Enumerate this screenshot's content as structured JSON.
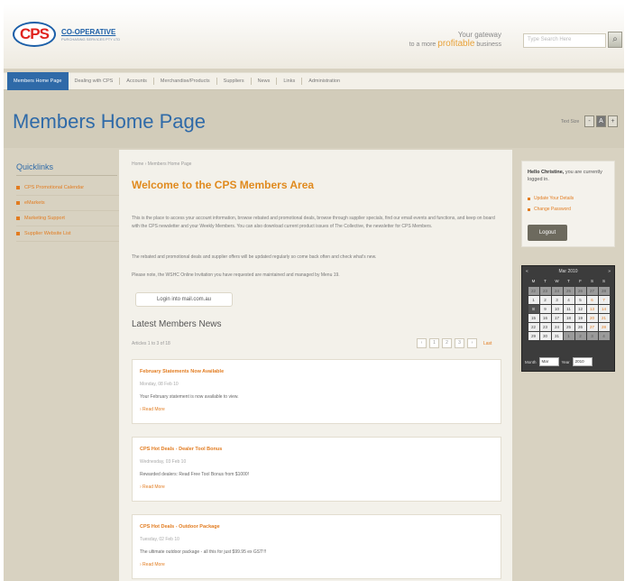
{
  "header": {
    "logo_mark": "CPS",
    "logo_name": "CO-OPERATIVE",
    "logo_sub": "PURCHASING SERVICES PTY LTD",
    "tagline_line1": "Your gateway",
    "tagline_pre": "to a more",
    "tagline_emph": "profitable",
    "tagline_post": "business",
    "search_placeholder": "Type Search Here",
    "search_icon": "search-icon"
  },
  "nav": {
    "items": [
      {
        "label": "Members Home Page",
        "active": true
      },
      {
        "label": "Dealing with CPS"
      },
      {
        "label": "Accounts"
      },
      {
        "label": "Merchandise/Products"
      },
      {
        "label": "Suppliers"
      },
      {
        "label": "News"
      },
      {
        "label": "Links"
      },
      {
        "label": "Administration"
      }
    ]
  },
  "page": {
    "title": "Members Home Page",
    "text_size_label": "Text Size",
    "text_size_buttons": [
      "-",
      "A",
      "+"
    ]
  },
  "quicklinks": {
    "title": "Quicklinks",
    "items": [
      "CPS Promotional Calendar",
      "eMarkets",
      "Marketing Support",
      "Supplier Website List"
    ]
  },
  "main": {
    "breadcrumb": "Home › Members Home Page",
    "welcome": "Welcome to the CPS Members Area",
    "intro": "This is the place to access your account information, browse rebated and promotional deals, browse through supplier specials, find our email events and functions, and keep on board with the CPS newsletter and your Weekly Members. You can also download current product issues of The Collective, the newsletter for CPS Members.",
    "para2": "The rebated and promotional deals and supplier offers will be updated regularly so come back often and check what's new.",
    "para3": "Please note, the WSHC Online Invitation you have requested are maintained and managed by Menu 19.",
    "login_link": "Login into mail.com.au",
    "news_heading": "Latest Members News",
    "news_count": "Articles 1 to 3 of 18",
    "pager": [
      "‹",
      "1",
      "2",
      "3",
      "›"
    ],
    "pager_last": "Last",
    "news": [
      {
        "title": "February Statements Now Available",
        "date": "Monday, 08 Feb 10",
        "body": "Your February statement is now available to view.",
        "more": "› Read More"
      },
      {
        "title": "CPS Hot Deals - Dealer Tool Bonus",
        "date": "Wednesday, 03 Feb 10",
        "body": "Rewarded dealers: Read Free Tool Bonus from $1000!",
        "more": "› Read More"
      },
      {
        "title": "CPS Hot Deals - Outdoor Package",
        "date": "Tuesday, 02 Feb 10",
        "body": "The ultimate outdoor package - all this for just $99.95 ex GST!!!",
        "more": "› Read More"
      }
    ]
  },
  "account": {
    "hello_name": "Hello Christine,",
    "hello_rest": "you are currently logged in.",
    "links": [
      "Update Your Details",
      "Change Password"
    ],
    "logout": "Logout"
  },
  "calendar": {
    "prev": "«",
    "month": "Mar 2010",
    "next": "»",
    "dow": [
      "M",
      "T",
      "W",
      "T",
      "F",
      "S",
      "S"
    ],
    "weeks": [
      [
        "22",
        "23",
        "24",
        "25",
        "26",
        "27",
        "28"
      ],
      [
        "1",
        "2",
        "3",
        "4",
        "5",
        "6",
        "7"
      ],
      [
        "8",
        "9",
        "10",
        "11",
        "12",
        "13",
        "14"
      ],
      [
        "15",
        "16",
        "17",
        "18",
        "19",
        "20",
        "21"
      ],
      [
        "22",
        "23",
        "24",
        "25",
        "26",
        "27",
        "28"
      ],
      [
        "29",
        "30",
        "31",
        "1",
        "2",
        "3",
        "4"
      ]
    ],
    "month_label": "Month",
    "month_value": "Mar",
    "year_label": "Year",
    "year_value": "2010"
  }
}
